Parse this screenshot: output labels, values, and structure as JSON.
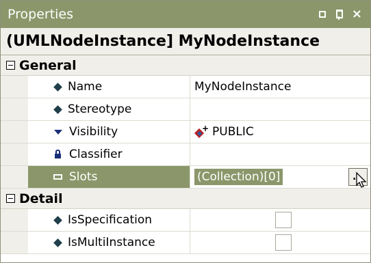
{
  "title": "Properties",
  "object_header": "(UMLNodeInstance] MyNodeInstance",
  "categories": [
    {
      "label": "General",
      "rows": [
        {
          "name": "Name",
          "value": "MyNodeInstance"
        },
        {
          "name": "Stereotype",
          "value": ""
        },
        {
          "name": "Visibility",
          "value": "PUBLIC"
        },
        {
          "name": "Classifier",
          "value": ""
        },
        {
          "name": "Slots",
          "value": "(Collection)[0]",
          "ellipsis": "..."
        }
      ]
    },
    {
      "label": "Detail",
      "rows": [
        {
          "name": "IsSpecification",
          "value": false
        },
        {
          "name": "IsMultiInstance",
          "value": false
        }
      ]
    }
  ],
  "icons": {
    "Name": "property-diamond-icon",
    "Stereotype": "property-diamond-icon",
    "Visibility": "dropdown-triangle-icon",
    "Classifier": "lock-icon",
    "Slots": "collection-icon",
    "IsSpecification": "property-diamond-icon",
    "IsMultiInstance": "property-diamond-icon"
  },
  "colors": {
    "accent": "#8b976a",
    "panel_bg": "#f0efe9"
  }
}
